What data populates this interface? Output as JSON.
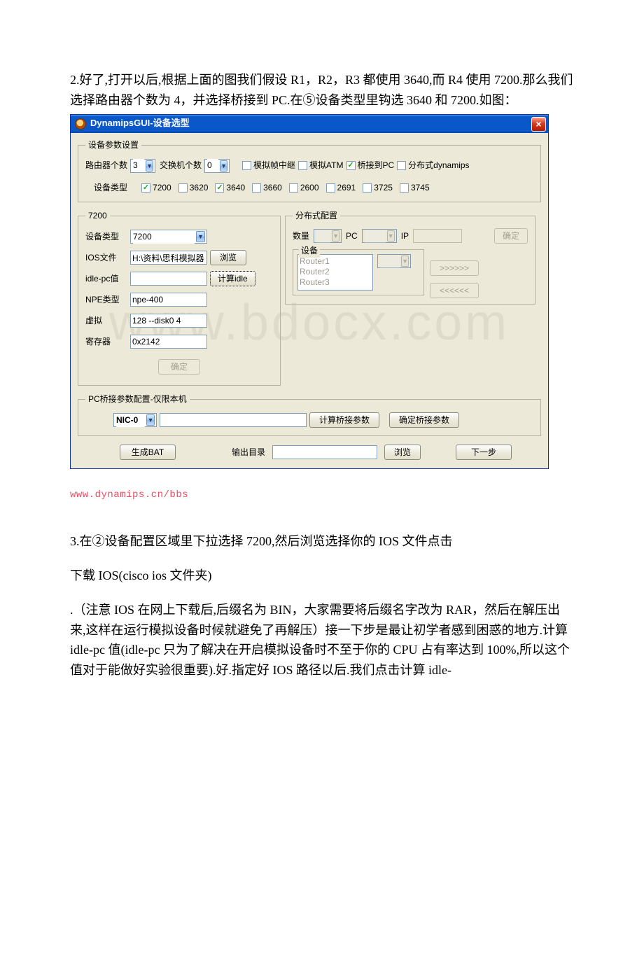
{
  "text": {
    "p2": "2.好了,打开以后,根据上面的图我们假设 R1，R2，R3 都使用 3640,而 R4 使用 7200.那么我们选择路由器个数为 4，并选择桥接到 PC.在⑤设备类型里钩选 3640 和 7200.如图：",
    "url": "www.dynamips.cn/bbs",
    "p3a": "3.在②设备配置区域里下拉选择 7200,然后浏览选择你的 IOS 文件点击",
    "p3b": "下载 IOS(cisco ios 文件夹)",
    "p3c": ".（注意 IOS 在网上下载后,后缀名为 BIN，大家需要将后缀名字改为 RAR，然后在解压出来,这样在运行模拟设备时候就避免了再解压）接一下步是最让初学者感到困惑的地方.计算 idle-pc 值(idle-pc 只为了解决在开启模拟设备时不至于你的 CPU 占有率达到 100%,所以这个值对于能做好实验很重要).好.指定好 IOS 路径以后.我们点击计算 idle-"
  },
  "watermark": "www.bdocx.com",
  "window": {
    "title": "DynamipsGUI-设备选型",
    "close": "×"
  },
  "groups": {
    "params": "设备参数设置",
    "g7200": "7200",
    "dist": "分布式配置",
    "dev_inner": "设备",
    "pc": "PC桥接参数配置-仅限本机"
  },
  "labels": {
    "router_count": "路由器个数",
    "switch_count": "交换机个数",
    "device_type_header": "设备类型",
    "device_type": "设备类型",
    "ios_file": "IOS文件",
    "idle_pc": "idle-pc值",
    "npe_type": "NPE类型",
    "virtual": "虚拟",
    "register": "寄存器",
    "qty": "数量",
    "pc": "PC",
    "ip": "IP",
    "nic": "NIC-0",
    "output_dir": "输出目录"
  },
  "values": {
    "router_count": "3",
    "switch_count": "0",
    "device_type": "7200",
    "ios_file": "H:\\资料\\思科模拟器",
    "idle_pc": "",
    "npe_type": "npe-400",
    "virtual": "128 --disk0 4",
    "register": "0x2142",
    "qty": "",
    "pc": "",
    "ip": "",
    "bridge_param": "",
    "output_dir": ""
  },
  "checkboxes": {
    "frame_relay": {
      "label": "模拟帧中继",
      "checked": false
    },
    "atm": {
      "label": "模拟ATM",
      "checked": false
    },
    "bridge_pc": {
      "label": "桥接到PC",
      "checked": true
    },
    "dist_dynamips": {
      "label": "分布式dynamips",
      "checked": false
    },
    "c7200": {
      "label": "7200",
      "checked": true
    },
    "c3620": {
      "label": "3620",
      "checked": false
    },
    "c3640": {
      "label": "3640",
      "checked": true
    },
    "c3660": {
      "label": "3660",
      "checked": false
    },
    "c2600": {
      "label": "2600",
      "checked": false
    },
    "c2691": {
      "label": "2691",
      "checked": false
    },
    "c3725": {
      "label": "3725",
      "checked": false
    },
    "c3745": {
      "label": "3745",
      "checked": false
    }
  },
  "buttons": {
    "browse": "浏览",
    "calc_idle": "计算idle",
    "ok": "确定",
    "ok_dist": "确定",
    "move_right": ">>>>>>",
    "move_left": "<<<<<<",
    "calc_bridge": "计算桥接参数",
    "confirm_bridge": "确定桥接参数",
    "gen_bat": "生成BAT",
    "browse_out": "浏览",
    "next": "下一步"
  },
  "dev_list": [
    "Router1",
    "Router2",
    "Router3"
  ],
  "nic_value": ""
}
